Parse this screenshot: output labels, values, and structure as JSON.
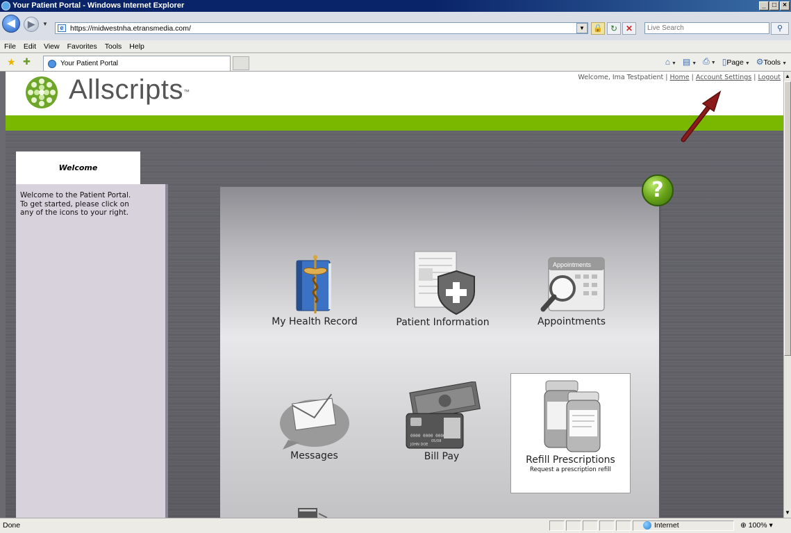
{
  "window": {
    "title": "Your Patient Portal - Windows Internet Explorer"
  },
  "address_bar": {
    "url": "https://midwestnha.etransmedia.com/",
    "search_placeholder": "Live Search"
  },
  "menu": [
    "File",
    "Edit",
    "View",
    "Favorites",
    "Tools",
    "Help"
  ],
  "tab": {
    "title": "Your Patient Portal"
  },
  "command_bar": {
    "page_label": "Page",
    "tools_label": "Tools"
  },
  "header": {
    "logo_text": "Allscripts",
    "trademark": "™",
    "welcome": "Welcome, Ima Testpatient",
    "sep": "|",
    "links": {
      "home": "Home",
      "account_settings": "Account Settings",
      "logout": "Logout"
    }
  },
  "sidebar": {
    "heading": "Welcome",
    "text": "Welcome to the Patient Portal. To get started, please click on any of the icons to your right."
  },
  "help": {
    "label": "?"
  },
  "tiles": {
    "health_record": "My Health Record",
    "patient_info": "Patient Information",
    "appointments": "Appointments",
    "appointments_card_label": "Appointments",
    "messages": "Messages",
    "bill_pay": "Bill Pay",
    "refill": "Refill Prescriptions",
    "refill_sub": "Request a prescription refill",
    "card_name": "JOHN DOE",
    "card_number": "0000 0000 0000 0000",
    "card_expiry": "05/08"
  },
  "status_bar": {
    "status": "Done",
    "zone": "Internet",
    "zoom": "100%"
  },
  "colors": {
    "brand_green": "#7ab800",
    "titlebar": "#0a246a",
    "annotation_arrow": "#8b1a1a"
  }
}
